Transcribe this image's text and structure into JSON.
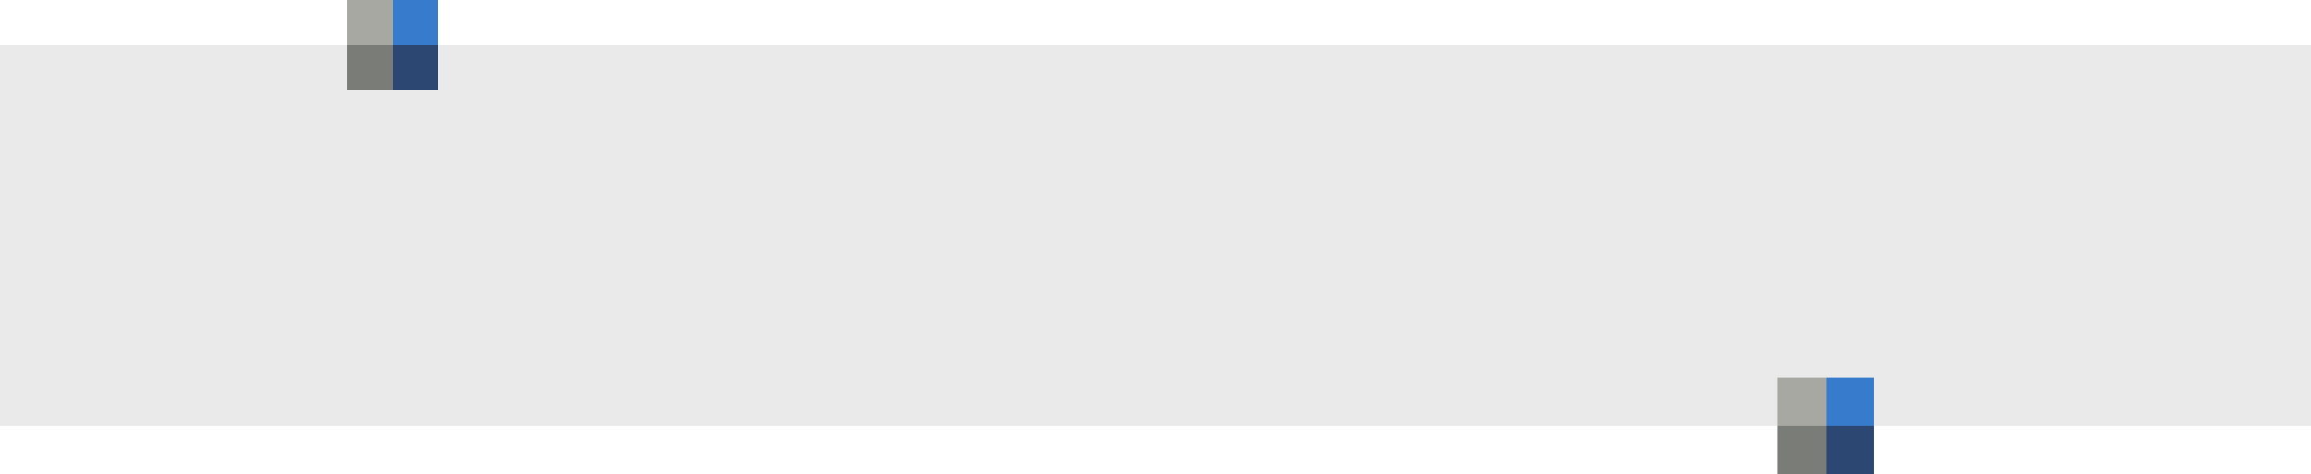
{
  "colors": {
    "page_background": "#ffffff",
    "band": "#eaeaea",
    "swatch_light_gray": "#a8a8a2",
    "swatch_blue": "#377ccc",
    "swatch_dark_gray": "#7a7c77",
    "swatch_navy": "#2b4772"
  },
  "swatch_groups": [
    {
      "id": "top-left",
      "swatches": [
        {
          "name": "light-gray-swatch",
          "color_key": "swatch_light_gray"
        },
        {
          "name": "blue-swatch",
          "color_key": "swatch_blue"
        },
        {
          "name": "dark-gray-swatch",
          "color_key": "swatch_dark_gray"
        },
        {
          "name": "navy-swatch",
          "color_key": "swatch_navy"
        }
      ]
    },
    {
      "id": "bottom-right",
      "swatches": [
        {
          "name": "light-gray-swatch",
          "color_key": "swatch_light_gray"
        },
        {
          "name": "blue-swatch",
          "color_key": "swatch_blue"
        },
        {
          "name": "dark-gray-swatch",
          "color_key": "swatch_dark_gray"
        },
        {
          "name": "navy-swatch",
          "color_key": "swatch_navy"
        }
      ]
    }
  ]
}
